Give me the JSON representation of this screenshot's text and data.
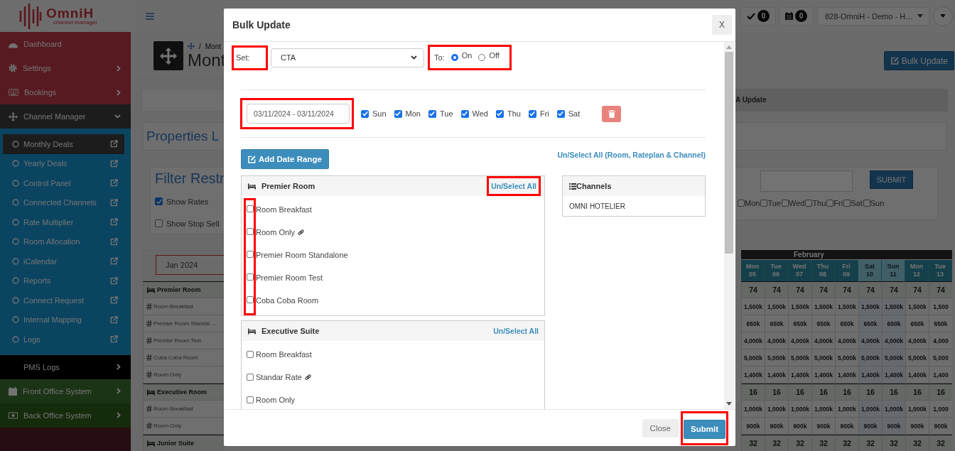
{
  "brand": {
    "name": "OmniH",
    "tagline": "channel manager"
  },
  "sidebar": {
    "items": [
      {
        "label": "Dashboard"
      },
      {
        "label": "Settings",
        "expanded": false
      },
      {
        "label": "Bookings",
        "expanded": false
      },
      {
        "label": "Channel Manager",
        "expanded": true,
        "children": [
          {
            "label": "Monthly Deals",
            "selected": true
          },
          {
            "label": "Yearly Deals",
            "selected": false
          },
          {
            "label": "Control Panel",
            "selected": false
          },
          {
            "label": "Connected Channels",
            "selected": false
          },
          {
            "label": "Rate Multiplier",
            "selected": false
          },
          {
            "label": "Room Allocation",
            "selected": false
          },
          {
            "label": "iCalendar",
            "selected": false
          },
          {
            "label": "Reports",
            "selected": false
          },
          {
            "label": "Connect Request",
            "selected": false
          },
          {
            "label": "Internal Mapping",
            "selected": false
          },
          {
            "label": "Logs",
            "selected": false
          }
        ]
      },
      {
        "label": "PMS Logs",
        "expanded": false
      },
      {
        "label": "Front Office System",
        "expanded": false
      },
      {
        "label": "Back Office System",
        "expanded": false
      }
    ]
  },
  "topbar": {
    "badges": [
      {
        "count": "0"
      },
      {
        "count": "0"
      }
    ],
    "property": "828-OmniH - Demo - H…"
  },
  "page": {
    "breadcrumb_separator": "/",
    "breadcrumb": "Mont",
    "title": "Mont",
    "bulk_button": "Bulk Update",
    "tab": "A Update",
    "properties_title": "Properties L"
  },
  "filter": {
    "title": "Filter Restr",
    "options": [
      {
        "label": "Show Rates",
        "checked": true
      },
      {
        "label": "Show Stop Sell",
        "checked": false
      }
    ],
    "submit": "SUBMIT",
    "days": [
      {
        "label": "Mon",
        "checked": false
      },
      {
        "label": "Tue",
        "checked": false
      },
      {
        "label": "Wed",
        "checked": false
      },
      {
        "label": "Thu",
        "checked": false
      },
      {
        "label": "Fri",
        "checked": false
      },
      {
        "label": "Sat",
        "checked": false
      },
      {
        "label": "Sun",
        "checked": false
      }
    ]
  },
  "calendar": {
    "month_picker": "Jan 2024",
    "month": "February",
    "columns": [
      {
        "day": "Mon",
        "date": "05",
        "weekend": false
      },
      {
        "day": "Tue",
        "date": "06",
        "weekend": false
      },
      {
        "day": "Wed",
        "date": "07",
        "weekend": false
      },
      {
        "day": "Thu",
        "date": "08",
        "weekend": false
      },
      {
        "day": "Fri",
        "date": "09",
        "weekend": false
      },
      {
        "day": "Sat",
        "date": "10",
        "weekend": true
      },
      {
        "day": "Sun",
        "date": "11",
        "weekend": true
      },
      {
        "day": "Mon",
        "date": "12",
        "weekend": false
      },
      {
        "day": "Tue",
        "date": "13",
        "weekend": false
      }
    ],
    "rows": [
      {
        "kind": "room",
        "label": "Premier Room",
        "values": [
          "74",
          "74",
          "74",
          "74",
          "74",
          "74",
          "74",
          "74",
          "74"
        ]
      },
      {
        "kind": "rate",
        "label": "Room Breakfast",
        "values": [
          "1,500k",
          "1,500k",
          "1,500k",
          "1,500k",
          "1,500k",
          "1,500k",
          "1,500k",
          "1,500k",
          "1,500"
        ]
      },
      {
        "kind": "rate",
        "label": "Premier Room Standal ...",
        "values": [
          "650k",
          "650k",
          "650k",
          "650k",
          "650k",
          "650k",
          "650k",
          "650k",
          "650k"
        ]
      },
      {
        "kind": "rate",
        "label": "Premier Room Test",
        "values": [
          "4,000k",
          "4,000k",
          "4,000k",
          "4,000k",
          "4,000k",
          "4,000k",
          "4,000k",
          "4,000k",
          "4,000"
        ]
      },
      {
        "kind": "rate",
        "label": "Coba Coba Room",
        "values": [
          "5,000k",
          "5,000k",
          "5,000k",
          "5,000k",
          "5,000k",
          "5,000k",
          "5,000k",
          "5,000k",
          "5,000"
        ]
      },
      {
        "kind": "rate",
        "label": "Room Only",
        "values": [
          "1,400k",
          "1,400k",
          "1,400k",
          "1,400k",
          "1,400k",
          "1,400k",
          "1,400k",
          "1,400k",
          "1,400"
        ]
      },
      {
        "kind": "room",
        "label": "Executive Room",
        "values": [
          "16",
          "16",
          "16",
          "16",
          "16",
          "16",
          "16",
          "16",
          "16"
        ]
      },
      {
        "kind": "rate",
        "label": "Room Breakfast",
        "values": [
          "1,000k",
          "1,000k",
          "1,000k",
          "1,000k",
          "1,000k",
          "1,000k",
          "1,000k",
          "1,000k",
          "1,000"
        ]
      },
      {
        "kind": "rate",
        "label": "Room Only",
        "values": [
          "900k",
          "900k",
          "900k",
          "900k",
          "900k",
          "900k",
          "900k",
          "900k",
          "900k"
        ]
      },
      {
        "kind": "room",
        "label": "Junior Suite",
        "values": [
          "32",
          "32",
          "32",
          "32",
          "32",
          "32",
          "32",
          "32",
          "32"
        ]
      }
    ]
  },
  "modal": {
    "title": "Bulk Update",
    "close": "X",
    "set": {
      "label": "Set:",
      "highlighted": true,
      "value": "CTA"
    },
    "to": {
      "label": "To:",
      "highlighted": true,
      "options": [
        {
          "label": "On",
          "selected": true
        },
        {
          "label": "Off",
          "selected": false
        }
      ]
    },
    "date_range": {
      "value": "03/11/2024 - 03/11/2024",
      "highlighted": true
    },
    "days": [
      {
        "label": "Sun",
        "checked": true
      },
      {
        "label": "Mon",
        "checked": true
      },
      {
        "label": "Tue",
        "checked": true
      },
      {
        "label": "Wed",
        "checked": true
      },
      {
        "label": "Thu",
        "checked": true
      },
      {
        "label": "Fri",
        "checked": true
      },
      {
        "label": "Sat",
        "checked": true
      }
    ],
    "add_button": "Add Date Range",
    "select_all_link": "Un/Select All (Room, Rateplan & Channel)",
    "rooms": [
      {
        "name": "Premier Room",
        "select_all": "Un/Select All",
        "link_highlighted": true,
        "checkboxes_highlighted": true,
        "rateplans": [
          {
            "label": "Room Breakfast",
            "checked": false,
            "linked": false
          },
          {
            "label": "Room Only",
            "checked": false,
            "linked": true
          },
          {
            "label": "Premier Room Standalone",
            "checked": false,
            "linked": false
          },
          {
            "label": "Premier Room Test",
            "checked": false,
            "linked": false
          },
          {
            "label": "Coba Coba Room",
            "checked": false,
            "linked": false
          }
        ]
      },
      {
        "name": "Executive Suite",
        "select_all": "Un/Select All",
        "link_highlighted": false,
        "checkboxes_highlighted": false,
        "rateplans": [
          {
            "label": "Room Breakfast",
            "checked": false,
            "linked": false
          },
          {
            "label": "Standar Rate",
            "checked": false,
            "linked": true
          },
          {
            "label": "Room Only",
            "checked": false,
            "linked": false
          }
        ]
      }
    ],
    "channels": {
      "title": "Channels",
      "items": [
        "OMNI HOTELIER"
      ]
    },
    "footer": {
      "close": "Close",
      "submit": "Submit",
      "submit_highlighted": true
    }
  }
}
